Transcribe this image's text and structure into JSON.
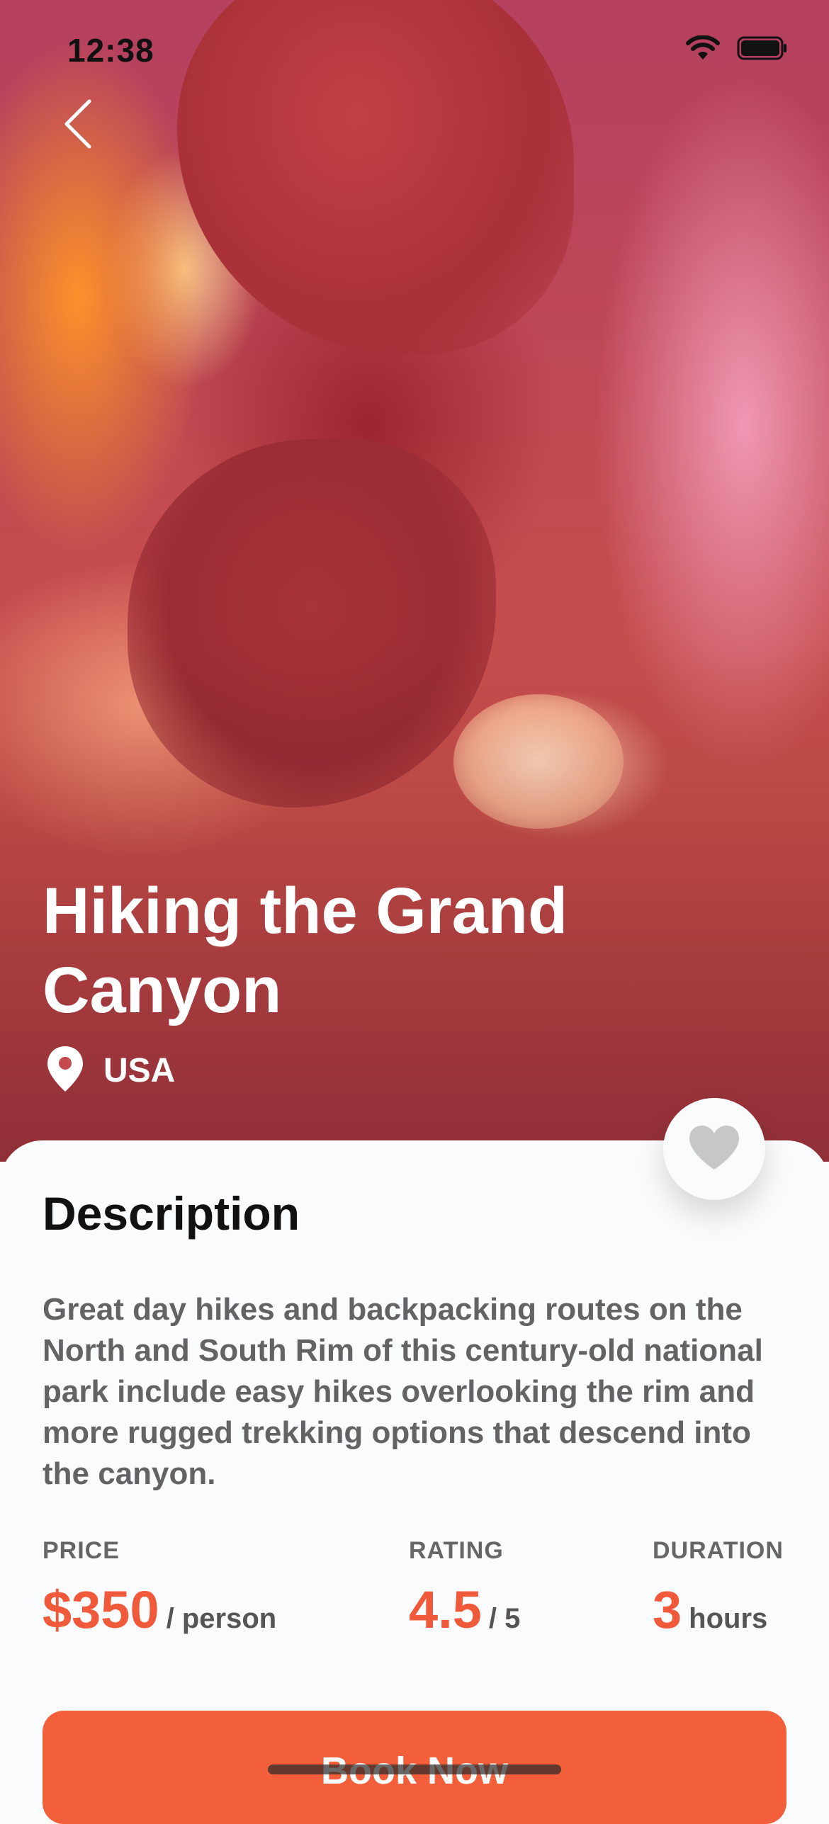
{
  "status_bar": {
    "time": "12:38",
    "icons": [
      "wifi-icon",
      "battery-icon"
    ]
  },
  "navigation": {
    "back_icon": "chevron-left-icon"
  },
  "trip": {
    "title": "Hiking the Grand Canyon",
    "location": "USA",
    "location_icon": "location-pin-icon",
    "favorite_icon": "heart-icon"
  },
  "description": {
    "heading": "Description",
    "text": "Great day hikes and backpacking routes on the North and South Rim of this century-old national park include easy hikes overlooking the rim and more rugged trekking options that descend into the canyon."
  },
  "stats": {
    "price": {
      "label": "PRICE",
      "value": "$350",
      "unit": "/ person"
    },
    "rating": {
      "label": "RATING",
      "value": "4.5",
      "unit": "/ 5"
    },
    "duration": {
      "label": "DURATION",
      "value": "3",
      "unit": "hours"
    }
  },
  "actions": {
    "book_label": "Book Now"
  },
  "colors": {
    "accent": "#f05a3a",
    "button": "#f35f3b",
    "background": "#fafbfd",
    "text_muted": "#636366"
  }
}
